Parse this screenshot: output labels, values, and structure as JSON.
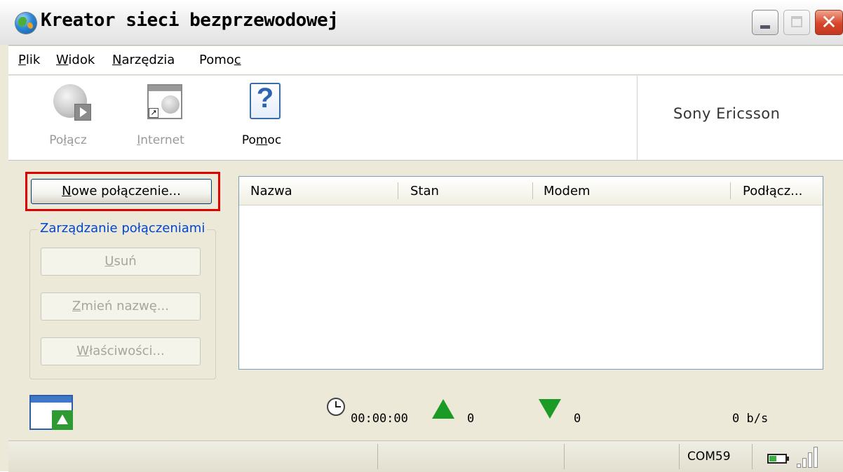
{
  "window": {
    "title": "Kreator sieci bezprzewodowej",
    "controls": {
      "minimize": "minimize",
      "maximize": "maximize",
      "close": "✕"
    }
  },
  "menu": {
    "items": [
      {
        "first": "P",
        "rest": "lik"
      },
      {
        "first": "W",
        "rest": "idok"
      },
      {
        "first": "N",
        "rest": "arzędzia"
      },
      {
        "pre": "Pomo",
        "u": "c"
      }
    ]
  },
  "toolbar": {
    "connect": {
      "pre": "Po",
      "u": "ł",
      "post": "ącz",
      "icon": "globe-play-icon",
      "enabled": false
    },
    "internet": {
      "u": "I",
      "post": "nternet",
      "icon": "browser-globe-icon",
      "enabled": false
    },
    "help": {
      "pre": "Po",
      "u": "m",
      "post": "oc",
      "icon": "help-icon",
      "enabled": true
    },
    "brand": "Sony Ericsson"
  },
  "connections": {
    "new_button": {
      "u": "N",
      "post": "owe połączenie..."
    },
    "group_title": "Zarządzanie połączeniami",
    "delete_button": {
      "u": "U",
      "post": "suń"
    },
    "rename_button": {
      "u": "Z",
      "post": "mień nazwę..."
    },
    "properties_button": {
      "u": "W",
      "post": "łaściwości..."
    }
  },
  "listview": {
    "columns": [
      "Nazwa",
      "Stan",
      "Modem",
      "Podłącz..."
    ],
    "rows": []
  },
  "stats": {
    "elapsed": "00:00:00",
    "sent": "0",
    "received": "0",
    "speed": "0 b/s"
  },
  "statusbar": {
    "port": "COM59",
    "battery_level": 0.45,
    "signal_bars": 4
  },
  "colors": {
    "highlight_border": "#e00000",
    "group_title": "#0046d5",
    "arrow_green": "#1c9a26"
  }
}
